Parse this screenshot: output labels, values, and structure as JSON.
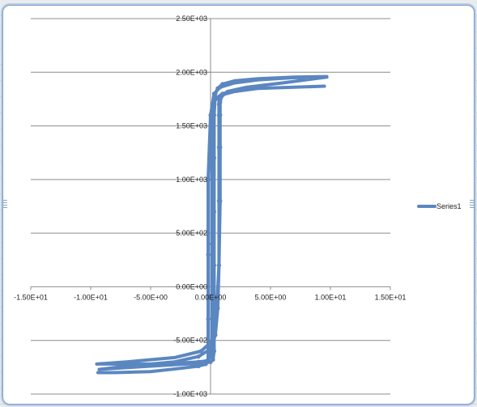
{
  "chart_data": {
    "type": "line",
    "title": "",
    "xlabel": "",
    "ylabel": "",
    "xlim": [
      -15,
      15
    ],
    "ylim": [
      -1000,
      2500
    ],
    "x_ticks": [
      -15,
      -10,
      -5,
      0,
      5,
      10,
      15
    ],
    "x_tick_labels": [
      "-1.50E+01",
      "-1.00E+01",
      "-5.00E+00",
      "0.00E+00",
      "5.00E+00",
      "1.00E+01",
      "1.50E+01"
    ],
    "y_ticks": [
      -1000,
      -500,
      0,
      500,
      1000,
      1500,
      2000,
      2500
    ],
    "y_tick_labels": [
      "-1.00E+03",
      "-5.00E+02",
      "0.00E+00",
      "5.00E+02",
      "1.00E+03",
      "1.50E+03",
      "2.00E+03",
      "2.50E+03"
    ],
    "grid": "horizontal",
    "legend": "right",
    "series": [
      {
        "name": "Series1",
        "color": "#5b87c1",
        "x": [
          9.7,
          7.0,
          4.0,
          2.0,
          1.0,
          0.6,
          0.4,
          0.3,
          0.3,
          0.3,
          0.3,
          0.3,
          0.3,
          0.2,
          0.0,
          -0.5,
          -2.0,
          -5.0,
          -8.0,
          -9.3,
          -7.0,
          -3.0,
          -1.0,
          0.0,
          0.4,
          0.6,
          0.7,
          0.7,
          0.7,
          0.7,
          0.7,
          0.7,
          1.0,
          2.0,
          4.0,
          7.0,
          9.5,
          7.0,
          4.0,
          2.0,
          1.0,
          0.5,
          0.2,
          0.1,
          0.1,
          0.1,
          0.1,
          0.1,
          0.0,
          -0.3,
          -1.0,
          -2.5,
          -5.0,
          -8.0,
          -9.5,
          -7.0,
          -3.0,
          -0.8,
          0.2,
          0.5,
          0.7,
          0.8,
          0.8,
          0.8,
          0.8,
          0.9,
          1.4,
          3.0,
          6.0,
          9.7,
          7.0,
          4.0,
          2.0,
          0.8,
          0.3,
          0.0,
          -0.2,
          -0.2,
          -0.2,
          -0.2,
          -0.2,
          -0.4,
          -1.0,
          -2.5,
          -5.0,
          -8.0,
          -9.4
        ],
        "y": [
          1960,
          1955,
          1940,
          1920,
          1890,
          1850,
          1800,
          1600,
          1200,
          700,
          200,
          -300,
          -600,
          -680,
          -700,
          -710,
          -720,
          -740,
          -760,
          -770,
          -740,
          -700,
          -650,
          -580,
          -450,
          -200,
          200,
          800,
          1300,
          1600,
          1700,
          1750,
          1790,
          1820,
          1850,
          1860,
          1870,
          1860,
          1850,
          1830,
          1800,
          1760,
          1700,
          1500,
          1000,
          400,
          -100,
          -500,
          -650,
          -690,
          -700,
          -710,
          -720,
          -720,
          -720,
          -700,
          -660,
          -600,
          -500,
          -250,
          200,
          800,
          1300,
          1600,
          1720,
          1770,
          1820,
          1860,
          1900,
          1955,
          1950,
          1930,
          1900,
          1860,
          1800,
          1600,
          1000,
          300,
          -300,
          -600,
          -700,
          -720,
          -740,
          -760,
          -790,
          -800,
          -800
        ]
      }
    ]
  }
}
